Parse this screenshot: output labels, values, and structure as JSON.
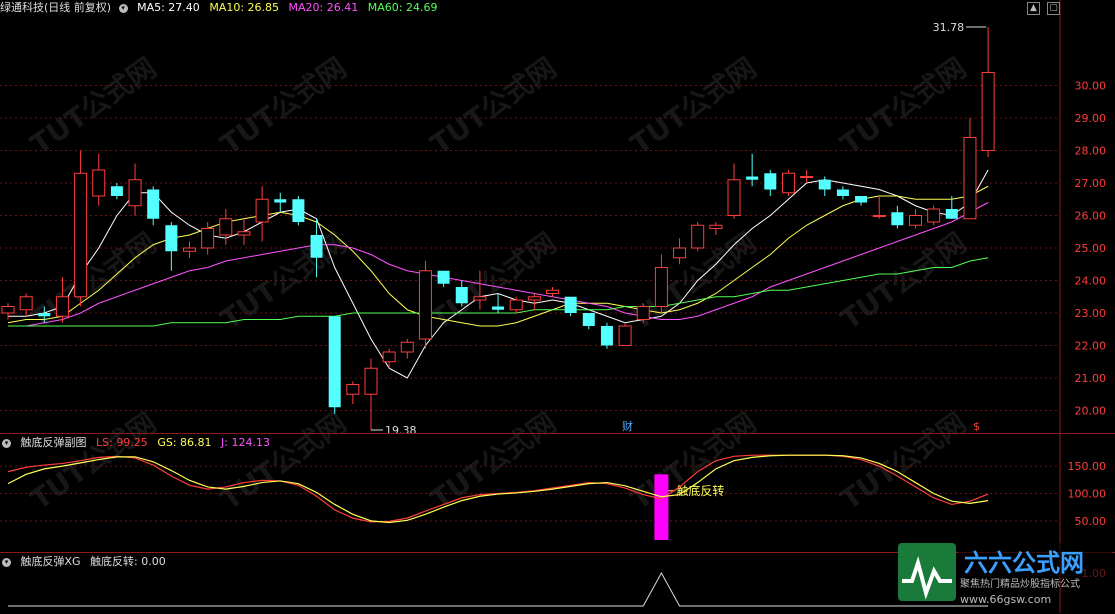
{
  "main_header": {
    "title": "绿通科技(日线 前复权)",
    "ma5": "MA5: 27.40",
    "ma10": "MA10: 26.85",
    "ma20": "MA20: 26.41",
    "ma60": "MA60: 24.69"
  },
  "sub1_header": {
    "title": "触底反弹副图",
    "ls": "LS: 99.25",
    "gs": "GS: 86.81",
    "j": "J: 124.13"
  },
  "sub2_header": {
    "title": "触底反弹XG",
    "value": "触底反转: 0.00"
  },
  "annotations": {
    "high_price": "31.78",
    "low_price": "19.38",
    "finance_marker": "财",
    "dollar_marker": "$",
    "signal_label": "触底反转",
    "sub2_axis_value": "1.00"
  },
  "watermark": "TUT公式网",
  "logo": {
    "brand": "六六公式网",
    "slogan": "聚焦热门精品炒股指标公式",
    "url": "www.66gsw.com"
  },
  "colors": {
    "up": "#ff3c3c",
    "down": "#54ffff",
    "ma5": "#ffffff",
    "ma10": "#ffff54",
    "ma20": "#ff54ff",
    "ma60": "#54ff54",
    "signal": "#ff00ff",
    "axis": "#ff3c3c"
  },
  "chart_data": [
    {
      "type": "candlestick",
      "title": "绿通科技(日线 前复权)",
      "y_ticks": [
        "30.00",
        "29.00",
        "28.00",
        "27.00",
        "26.00",
        "25.00",
        "24.00",
        "23.00",
        "22.00",
        "21.00",
        "20.00"
      ],
      "ylim": [
        19.4,
        32.2
      ],
      "candles": [
        {
          "o": 23.0,
          "h": 23.3,
          "l": 22.8,
          "c": 23.2
        },
        {
          "o": 23.1,
          "h": 23.6,
          "l": 22.9,
          "c": 23.5
        },
        {
          "o": 23.0,
          "h": 23.2,
          "l": 22.7,
          "c": 22.9
        },
        {
          "o": 22.9,
          "h": 24.1,
          "l": 22.7,
          "c": 23.5
        },
        {
          "o": 23.5,
          "h": 28.0,
          "l": 23.2,
          "c": 27.3
        },
        {
          "o": 26.6,
          "h": 27.9,
          "l": 26.3,
          "c": 27.4
        },
        {
          "o": 26.9,
          "h": 27.0,
          "l": 26.5,
          "c": 26.6
        },
        {
          "o": 26.3,
          "h": 27.6,
          "l": 26.0,
          "c": 27.1
        },
        {
          "o": 26.8,
          "h": 26.9,
          "l": 25.7,
          "c": 25.9
        },
        {
          "o": 25.7,
          "h": 25.8,
          "l": 24.3,
          "c": 24.9
        },
        {
          "o": 24.9,
          "h": 25.2,
          "l": 24.7,
          "c": 25.0
        },
        {
          "o": 25.0,
          "h": 25.8,
          "l": 24.8,
          "c": 25.6
        },
        {
          "o": 25.4,
          "h": 26.2,
          "l": 25.1,
          "c": 25.9
        },
        {
          "o": 25.4,
          "h": 25.9,
          "l": 25.1,
          "c": 25.5
        },
        {
          "o": 25.8,
          "h": 26.9,
          "l": 25.2,
          "c": 26.5
        },
        {
          "o": 26.5,
          "h": 26.7,
          "l": 26.1,
          "c": 26.4
        },
        {
          "o": 26.5,
          "h": 26.6,
          "l": 25.7,
          "c": 25.8
        },
        {
          "o": 25.4,
          "h": 25.9,
          "l": 24.1,
          "c": 24.7
        },
        {
          "o": 22.9,
          "h": 22.9,
          "l": 19.9,
          "c": 20.1
        },
        {
          "o": 20.5,
          "h": 20.9,
          "l": 20.2,
          "c": 20.8
        },
        {
          "o": 20.5,
          "h": 21.6,
          "l": 19.4,
          "c": 21.3
        },
        {
          "o": 21.5,
          "h": 21.9,
          "l": 21.3,
          "c": 21.8
        },
        {
          "o": 21.8,
          "h": 22.2,
          "l": 21.6,
          "c": 22.1
        },
        {
          "o": 22.2,
          "h": 24.6,
          "l": 21.9,
          "c": 24.3
        },
        {
          "o": 24.3,
          "h": 24.3,
          "l": 23.8,
          "c": 23.9
        },
        {
          "o": 23.8,
          "h": 24.0,
          "l": 23.2,
          "c": 23.3
        },
        {
          "o": 23.4,
          "h": 24.3,
          "l": 23.1,
          "c": 23.5
        },
        {
          "o": 23.2,
          "h": 23.6,
          "l": 23.0,
          "c": 23.1
        },
        {
          "o": 23.1,
          "h": 23.5,
          "l": 23.0,
          "c": 23.4
        },
        {
          "o": 23.4,
          "h": 23.6,
          "l": 23.1,
          "c": 23.5
        },
        {
          "o": 23.6,
          "h": 23.8,
          "l": 23.5,
          "c": 23.7
        },
        {
          "o": 23.5,
          "h": 23.5,
          "l": 22.9,
          "c": 23.0
        },
        {
          "o": 23.0,
          "h": 23.0,
          "l": 22.5,
          "c": 22.6
        },
        {
          "o": 22.6,
          "h": 22.7,
          "l": 21.9,
          "c": 22.0
        },
        {
          "o": 22.0,
          "h": 22.7,
          "l": 22.0,
          "c": 22.6
        },
        {
          "o": 22.8,
          "h": 23.3,
          "l": 22.7,
          "c": 23.2
        },
        {
          "o": 23.2,
          "h": 24.8,
          "l": 23.0,
          "c": 24.4
        },
        {
          "o": 24.7,
          "h": 25.3,
          "l": 24.5,
          "c": 25.0
        },
        {
          "o": 25.0,
          "h": 25.8,
          "l": 24.9,
          "c": 25.7
        },
        {
          "o": 25.6,
          "h": 25.8,
          "l": 25.4,
          "c": 25.7
        },
        {
          "o": 26.0,
          "h": 27.6,
          "l": 25.9,
          "c": 27.1
        },
        {
          "o": 27.2,
          "h": 27.9,
          "l": 26.9,
          "c": 27.1
        },
        {
          "o": 27.3,
          "h": 27.4,
          "l": 26.6,
          "c": 26.8
        },
        {
          "o": 26.7,
          "h": 27.4,
          "l": 26.6,
          "c": 27.3
        },
        {
          "o": 27.2,
          "h": 27.4,
          "l": 27.0,
          "c": 27.2
        },
        {
          "o": 27.1,
          "h": 27.2,
          "l": 26.6,
          "c": 26.8
        },
        {
          "o": 26.8,
          "h": 26.9,
          "l": 26.5,
          "c": 26.6
        },
        {
          "o": 26.6,
          "h": 26.6,
          "l": 26.3,
          "c": 26.4
        },
        {
          "o": 26.0,
          "h": 26.6,
          "l": 25.9,
          "c": 26.0
        },
        {
          "o": 26.1,
          "h": 26.3,
          "l": 25.6,
          "c": 25.7
        },
        {
          "o": 25.7,
          "h": 26.2,
          "l": 25.6,
          "c": 26.0
        },
        {
          "o": 25.8,
          "h": 26.3,
          "l": 25.7,
          "c": 26.2
        },
        {
          "o": 26.2,
          "h": 26.6,
          "l": 25.9,
          "c": 25.9
        },
        {
          "o": 25.9,
          "h": 29.0,
          "l": 25.9,
          "c": 28.4
        },
        {
          "o": 28.0,
          "h": 31.8,
          "l": 27.8,
          "c": 30.4
        }
      ],
      "series": [
        {
          "name": "MA5",
          "values": [
            22.9,
            22.9,
            23.0,
            23.2,
            24.2,
            25.0,
            26.0,
            26.7,
            26.7,
            26.1,
            25.7,
            25.4,
            25.3,
            25.5,
            25.8,
            26.1,
            26.2,
            25.9,
            24.4,
            23.3,
            22.2,
            21.3,
            21.0,
            22.0,
            22.7,
            23.1,
            23.5,
            23.6,
            23.4,
            23.3,
            23.4,
            23.3,
            23.1,
            22.9,
            22.7,
            22.8,
            22.9,
            23.3,
            24.0,
            24.5,
            25.1,
            25.6,
            26.0,
            26.5,
            27.0,
            27.1,
            27.0,
            26.9,
            26.8,
            26.6,
            26.3,
            26.1,
            26.0,
            26.4,
            27.4
          ]
        },
        {
          "name": "MA10",
          "values": [
            22.7,
            22.8,
            22.8,
            22.9,
            23.3,
            23.7,
            24.2,
            24.7,
            25.1,
            25.3,
            25.4,
            25.6,
            25.8,
            25.9,
            26.0,
            26.1,
            26.0,
            25.8,
            25.4,
            24.9,
            24.3,
            23.6,
            23.1,
            22.9,
            22.8,
            22.7,
            22.6,
            22.6,
            22.7,
            22.9,
            23.1,
            23.3,
            23.3,
            23.3,
            23.2,
            23.1,
            23.0,
            23.1,
            23.3,
            23.6,
            24.0,
            24.4,
            24.8,
            25.3,
            25.7,
            26.0,
            26.3,
            26.5,
            26.6,
            26.6,
            26.5,
            26.5,
            26.5,
            26.6,
            26.9
          ]
        },
        {
          "name": "MA20",
          "values": [
            22.6,
            22.6,
            22.7,
            22.8,
            23.0,
            23.3,
            23.5,
            23.7,
            23.9,
            24.1,
            24.3,
            24.4,
            24.6,
            24.7,
            24.8,
            24.9,
            25.0,
            25.1,
            25.1,
            25.0,
            24.8,
            24.5,
            24.3,
            24.2,
            24.1,
            24.0,
            23.9,
            23.8,
            23.7,
            23.6,
            23.5,
            23.4,
            23.3,
            23.2,
            23.0,
            22.9,
            22.8,
            22.8,
            22.9,
            23.1,
            23.3,
            23.5,
            23.8,
            24.0,
            24.2,
            24.4,
            24.6,
            24.8,
            25.0,
            25.2,
            25.4,
            25.6,
            25.8,
            26.1,
            26.4
          ]
        },
        {
          "name": "MA60",
          "values": [
            22.6,
            22.6,
            22.6,
            22.6,
            22.6,
            22.6,
            22.6,
            22.6,
            22.6,
            22.7,
            22.7,
            22.7,
            22.7,
            22.8,
            22.8,
            22.8,
            22.9,
            22.9,
            22.9,
            23.0,
            23.0,
            23.0,
            23.0,
            23.0,
            23.0,
            23.0,
            23.0,
            23.0,
            23.0,
            23.1,
            23.1,
            23.1,
            23.1,
            23.1,
            23.2,
            23.2,
            23.2,
            23.3,
            23.4,
            23.5,
            23.5,
            23.6,
            23.7,
            23.7,
            23.8,
            23.9,
            24.0,
            24.1,
            24.2,
            24.2,
            24.3,
            24.4,
            24.4,
            24.6,
            24.7
          ]
        }
      ]
    },
    {
      "type": "line",
      "title": "触底反弹副图",
      "y_ticks": [
        "150.00",
        "100.00",
        "50.00"
      ],
      "ylim": [
        15,
        185
      ],
      "series": [
        {
          "name": "LS",
          "values": [
            140,
            148,
            152,
            155,
            160,
            166,
            168,
            165,
            152,
            132,
            115,
            108,
            112,
            120,
            124,
            123,
            115,
            95,
            70,
            55,
            48,
            49,
            55,
            68,
            80,
            92,
            98,
            100,
            102,
            105,
            110,
            115,
            120,
            118,
            110,
            98,
            90,
            112,
            140,
            160,
            168,
            170,
            170,
            170,
            170,
            170,
            168,
            162,
            150,
            132,
            112,
            92,
            80,
            86,
            99
          ]
        },
        {
          "name": "GS",
          "values": [
            118,
            135,
            145,
            150,
            156,
            162,
            167,
            167,
            158,
            142,
            124,
            112,
            108,
            113,
            120,
            123,
            118,
            102,
            80,
            62,
            50,
            47,
            51,
            62,
            75,
            87,
            95,
            99,
            101,
            104,
            108,
            113,
            118,
            120,
            114,
            104,
            94,
            98,
            120,
            145,
            160,
            166,
            169,
            170,
            170,
            170,
            169,
            165,
            155,
            140,
            120,
            100,
            86,
            82,
            87
          ]
        }
      ],
      "signal_at": 36
    },
    {
      "type": "line",
      "title": "触底反弹XG",
      "y_ticks": [
        "1.00"
      ],
      "ylim": [
        0,
        1
      ],
      "series": [
        {
          "name": "触底反转",
          "values": [
            0,
            0,
            0,
            0,
            0,
            0,
            0,
            0,
            0,
            0,
            0,
            0,
            0,
            0,
            0,
            0,
            0,
            0,
            0,
            0,
            0,
            0,
            0,
            0,
            0,
            0,
            0,
            0,
            0,
            0,
            0,
            0,
            0,
            0,
            0,
            0,
            1,
            0,
            0,
            0,
            0,
            0,
            0,
            0,
            0,
            0,
            0,
            0,
            0,
            0,
            0,
            0,
            0,
            0,
            0
          ]
        }
      ]
    }
  ]
}
